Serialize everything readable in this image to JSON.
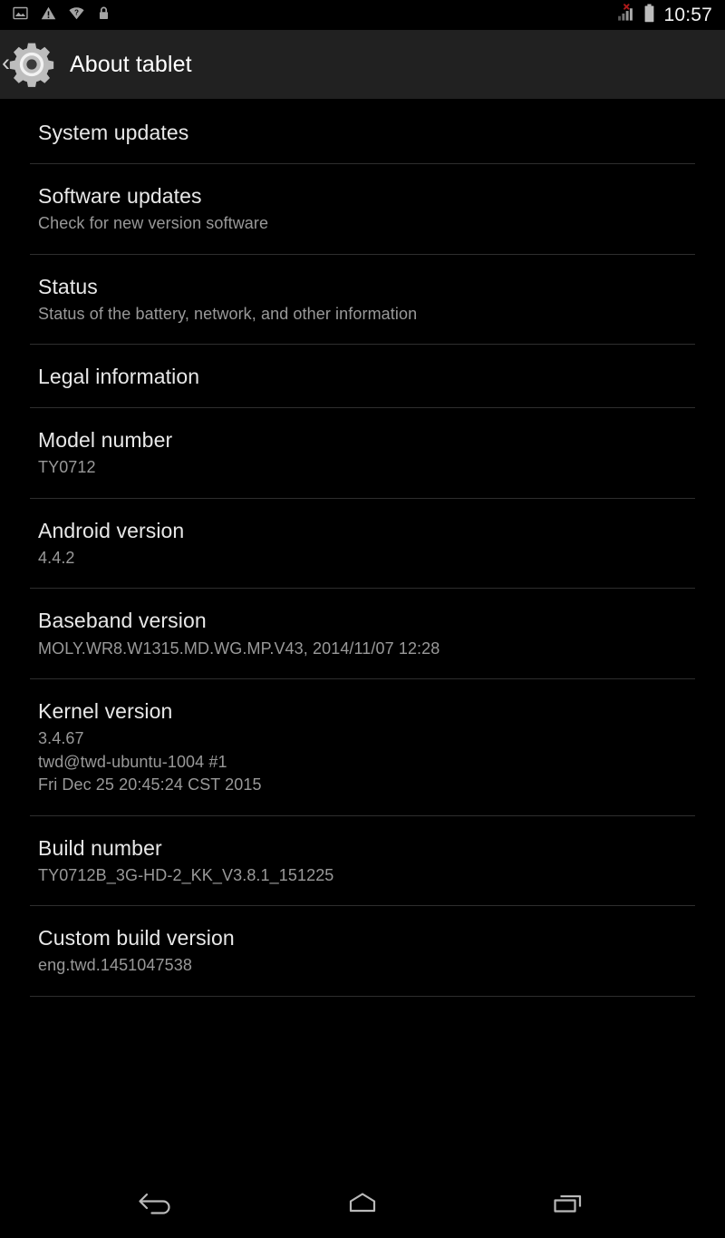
{
  "status_bar": {
    "icons_left": [
      {
        "name": "screenshot-icon",
        "label": "Screenshot captured"
      },
      {
        "name": "warning-icon",
        "label": "Warning"
      },
      {
        "name": "wifi-unknown-icon",
        "label": "Wi-Fi unknown"
      },
      {
        "name": "lock-icon",
        "label": "Screen locked"
      }
    ],
    "icons_right": [
      {
        "name": "signal-no-sim-icon",
        "label": "No SIM card"
      },
      {
        "name": "battery-icon",
        "label": "Battery"
      }
    ],
    "clock": "10:57"
  },
  "action_bar": {
    "back_chevron": "‹",
    "icon": "settings-gear-icon",
    "title": "About tablet"
  },
  "list": {
    "items": [
      {
        "name": "system-updates",
        "title": "System updates",
        "sub": []
      },
      {
        "name": "software-updates",
        "title": "Software updates",
        "sub": [
          "Check for new version software"
        ]
      },
      {
        "name": "status",
        "title": "Status",
        "sub": [
          "Status of the battery, network, and other information"
        ]
      },
      {
        "name": "legal-information",
        "title": "Legal information",
        "sub": []
      },
      {
        "name": "model-number",
        "title": "Model number",
        "sub": [
          "TY0712"
        ]
      },
      {
        "name": "android-version",
        "title": "Android version",
        "sub": [
          "4.4.2"
        ]
      },
      {
        "name": "baseband-version",
        "title": "Baseband version",
        "sub": [
          "MOLY.WR8.W1315.MD.WG.MP.V43, 2014/11/07 12:28"
        ]
      },
      {
        "name": "kernel-version",
        "title": "Kernel version",
        "sub": [
          "3.4.67",
          "twd@twd-ubuntu-1004 #1",
          "Fri Dec 25 20:45:24 CST 2015"
        ]
      },
      {
        "name": "build-number",
        "title": "Build number",
        "sub": [
          "TY0712B_3G-HD-2_KK_V3.8.1_151225"
        ]
      },
      {
        "name": "custom-build-version",
        "title": "Custom build version",
        "sub": [
          "eng.twd.1451047538"
        ]
      }
    ]
  },
  "nav_bar": {
    "buttons": [
      {
        "name": "nav-back-button",
        "label": "Back"
      },
      {
        "name": "nav-home-button",
        "label": "Home"
      },
      {
        "name": "nav-recents-button",
        "label": "Recent apps"
      }
    ]
  },
  "colors": {
    "background": "#000000",
    "action_bar": "#212121",
    "title_text": "#e8e8e8",
    "summary_text": "#999999",
    "divider": "#2e2e2e",
    "icon_gray": "#bdbdbd",
    "alert_red": "#d32020"
  }
}
